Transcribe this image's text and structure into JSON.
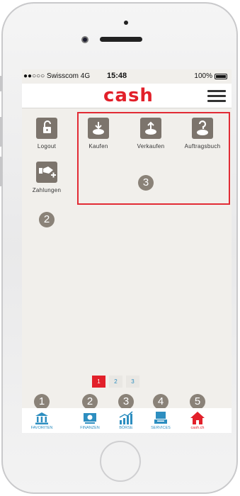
{
  "status": {
    "carrier": "●●○○○ Swisscom  4G",
    "time": "15:48",
    "battery": "100%"
  },
  "header": {
    "logo": "cash"
  },
  "left_tiles": [
    {
      "label": "Logout",
      "icon": "unlock-icon"
    },
    {
      "label": "Zahlungen",
      "icon": "payment-add-icon"
    }
  ],
  "trade_tiles": [
    {
      "label": "Kaufen",
      "icon": "buy-icon"
    },
    {
      "label": "Verkaufen",
      "icon": "sell-icon"
    },
    {
      "label": "Auftragsbuch",
      "icon": "orderbook-icon"
    }
  ],
  "markers": {
    "left": "2",
    "box": "3",
    "tab1": "1",
    "tab2": "2",
    "tab3": "3",
    "tab4": "4",
    "tab5": "5"
  },
  "pager": [
    "1",
    "2",
    "3"
  ],
  "tabs": [
    {
      "label": "FAVORITEN",
      "icon": "bank-icon"
    },
    {
      "label": "FINANZEN",
      "icon": "money-icon"
    },
    {
      "label": "BÖRSE",
      "icon": "chart-icon"
    },
    {
      "label": "SERVICES",
      "icon": "services-icon"
    },
    {
      "label": "cash.ch",
      "icon": "home-icon"
    }
  ],
  "colors": {
    "brand": "#e2202a",
    "tile": "#7c746c",
    "tab": "#2d8ec0",
    "marker": "#8a8278"
  }
}
